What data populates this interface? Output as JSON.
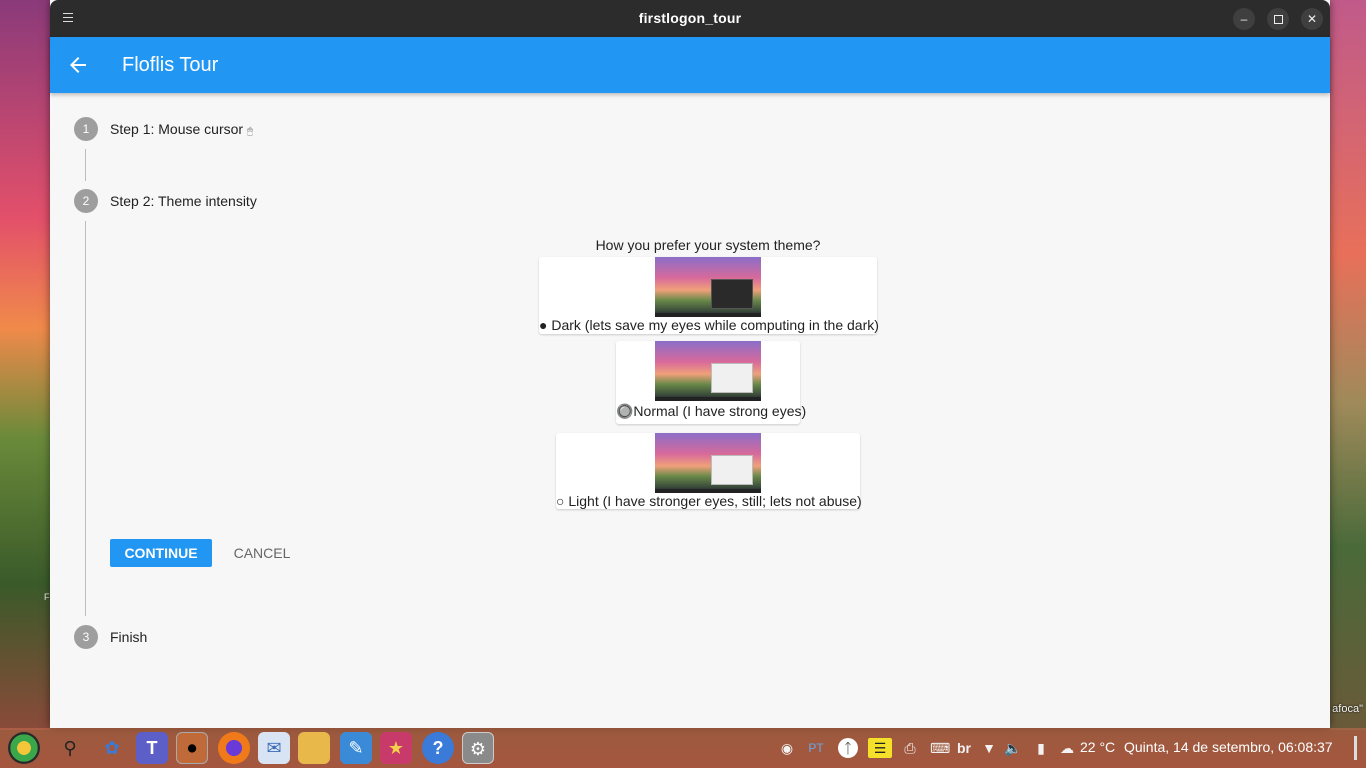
{
  "window": {
    "title": "firstlogon_tour"
  },
  "appbar": {
    "title": "Floflis Tour"
  },
  "steps": [
    {
      "number": "1",
      "label": "Step 1: Mouse cursor",
      "suffix": "🖱"
    },
    {
      "number": "2",
      "label": "Step 2: Theme intensity"
    },
    {
      "number": "3",
      "label": "Finish"
    }
  ],
  "theme_step": {
    "question": "How you prefer your system theme?",
    "options": [
      {
        "id": "dark",
        "label": "● Dark (lets save my eyes while computing in the dark)",
        "selected": true
      },
      {
        "id": "normal",
        "label": "🔘Normal (I have strong eyes)",
        "selected": false
      },
      {
        "id": "light",
        "label": "○ Light (I have stronger eyes, still; lets not abuse)",
        "selected": false
      }
    ],
    "continue_label": "CONTINUE",
    "cancel_label": "CANCEL"
  },
  "desktop": {
    "snippet": "afoca\"",
    "side_letter": "F"
  },
  "taskbar": {
    "tray": {
      "lang_indicator": "PT",
      "keyboard_layout": "br",
      "temperature": "22 °C",
      "clock": "Quinta, 14 de setembro, 06:08:37"
    }
  },
  "colors": {
    "accent": "#2196f3",
    "titlebar": "#2c2c2c",
    "step_circle": "#9e9e9e"
  }
}
